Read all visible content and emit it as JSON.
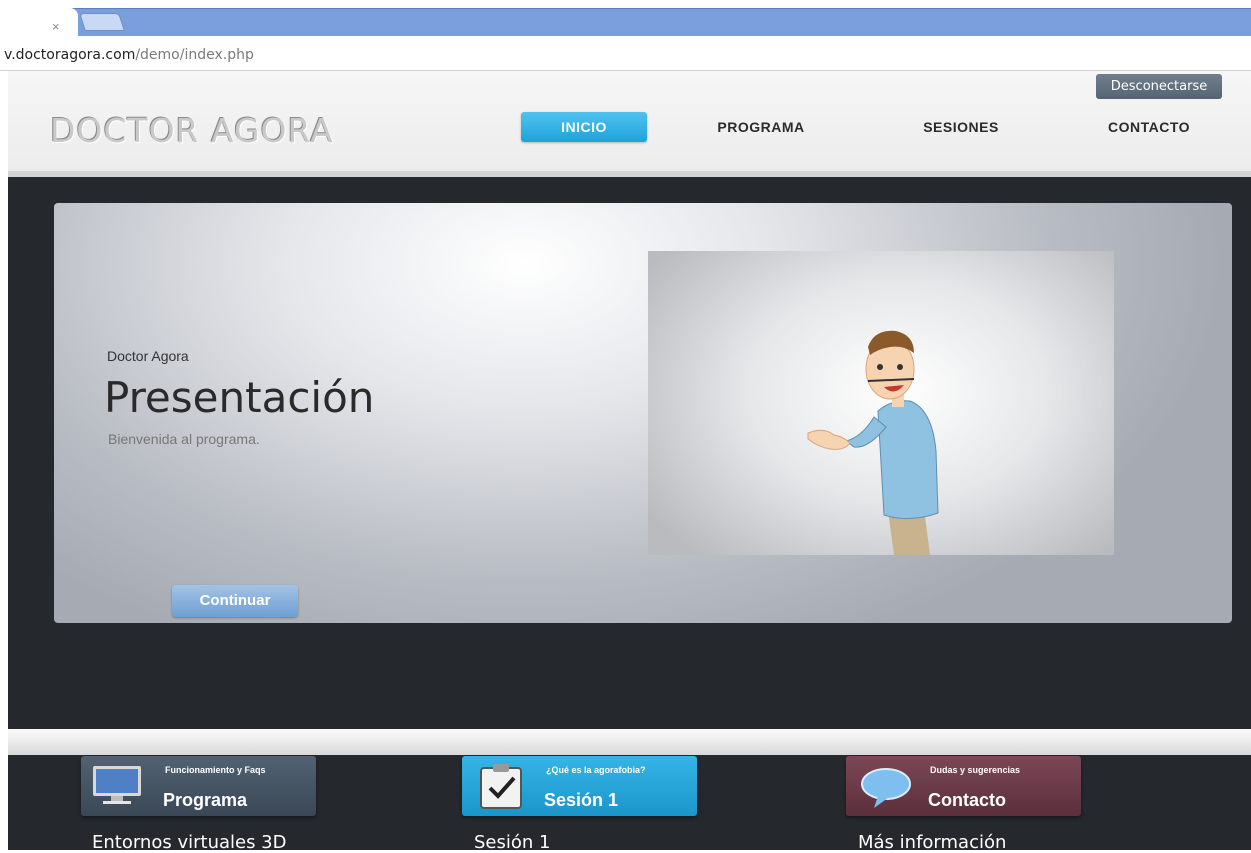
{
  "browser": {
    "tab_close": "×",
    "url_domain": "v.doctoragora.com",
    "url_path": "/demo/index.php"
  },
  "header": {
    "logo": "DOCTOR AGORA",
    "logout_label": "Desconectarse",
    "nav": [
      {
        "label": "INICIO",
        "active": true
      },
      {
        "label": "PROGRAMA"
      },
      {
        "label": "SESIONES"
      },
      {
        "label": "CONTACTO"
      }
    ]
  },
  "hero": {
    "kicker": "Doctor Agora",
    "title": "Presentación",
    "subtitle": "Bienvenida al programa.",
    "continue_label": "Continuar",
    "video_icon": "doctor-character-illustration"
  },
  "cards": [
    {
      "small": "Funcionamiento y Faqs",
      "big": "Programa",
      "label": "Entornos virtuales 3D",
      "color": "#3c4b59",
      "icon": "computer-monitor-icon"
    },
    {
      "small": "¿Qué es la agorafobia?",
      "big": "Sesión 1",
      "label": "Sesión 1",
      "color": "#1d9fd4",
      "icon": "clipboard-check-icon"
    },
    {
      "small": "Dudas y sugerencias",
      "big": "Contacto",
      "label": "Más información",
      "color": "#6b3a48",
      "icon": "speech-bubble-icon"
    }
  ],
  "colors": {
    "accent_blue": "#1ea3d9",
    "dark_band": "#25282d"
  }
}
